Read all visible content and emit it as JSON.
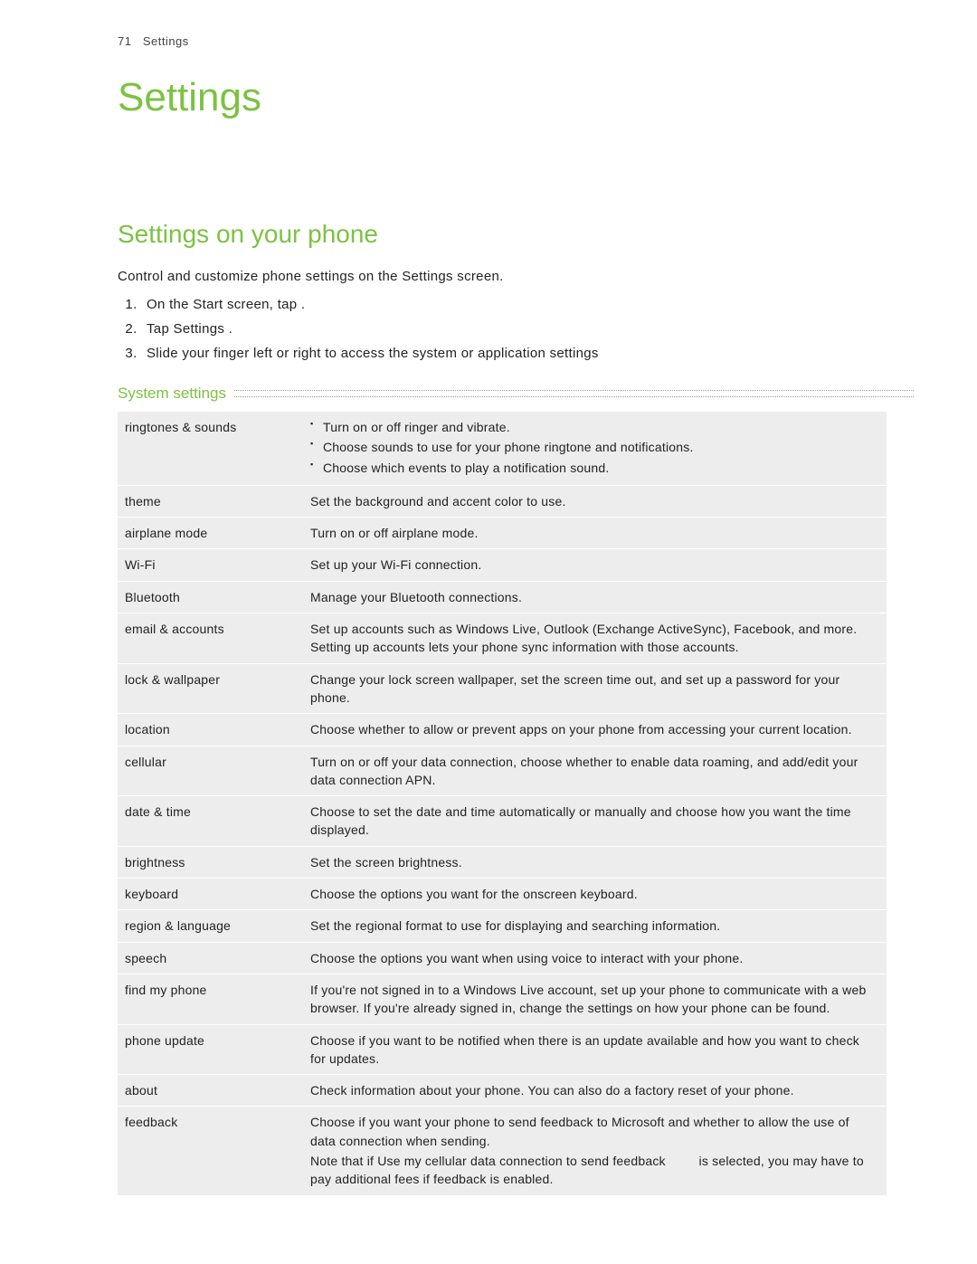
{
  "header": {
    "page_num": "71",
    "section": "Settings"
  },
  "chapter_title": "Settings",
  "section_title": "Settings on your phone",
  "intro": "Control and customize phone settings on the Settings screen.",
  "steps": [
    "On the Start screen, tap        .",
    "Tap Settings .",
    "Slide your finger left or right to access the system or application settings"
  ],
  "subsection_title": "System settings",
  "rows": [
    {
      "label": "ringtones & sounds",
      "bullets": [
        "Turn on or off ringer and vibrate.",
        "Choose sounds to use for your phone ringtone and notifications.",
        "Choose which events to play a notification sound."
      ]
    },
    {
      "label": "theme",
      "desc": "Set the background and accent color to use."
    },
    {
      "label": "airplane mode",
      "desc": "Turn on or off airplane mode."
    },
    {
      "label": "Wi-Fi",
      "desc": "Set up your Wi-Fi connection."
    },
    {
      "label": "Bluetooth",
      "desc": "Manage your Bluetooth connections."
    },
    {
      "label": "email & accounts",
      "desc": "Set up accounts such as Windows Live, Outlook (Exchange ActiveSync), Facebook, and more. Setting up accounts lets your phone sync information with those accounts."
    },
    {
      "label": "lock & wallpaper",
      "desc": "Change your lock screen wallpaper, set the screen time out, and set up a password for your phone."
    },
    {
      "label": "location",
      "desc": "Choose whether to allow or prevent apps on your phone from accessing your current location."
    },
    {
      "label": "cellular",
      "desc": "Turn on or off your data connection, choose whether to enable data roaming, and add/edit your data connection APN."
    },
    {
      "label": "date & time",
      "desc": "Choose to set the date and time automatically or manually and choose how you want the time displayed."
    },
    {
      "label": "brightness",
      "desc": "Set the screen brightness."
    },
    {
      "label": "keyboard",
      "desc": "Choose the options you want for the onscreen keyboard."
    },
    {
      "label": "region & language",
      "desc": "Set the regional format to use for displaying and searching information."
    },
    {
      "label": "speech",
      "desc": "Choose the options you want when using voice to interact with your phone."
    },
    {
      "label": "find my phone",
      "desc": "If you're not signed in to a Windows Live account, set up your phone to communicate with a web browser. If you're already signed in, change the settings on how your phone can be found."
    },
    {
      "label": "phone update",
      "desc": "Choose if you want to be notified when there is an update available and how you want to check for updates."
    },
    {
      "label": "about",
      "desc": "Check information about your phone. You can also do a factory reset of your phone."
    },
    {
      "label": "feedback",
      "desc": "Choose if you want your phone to send feedback to Microsoft and whether to allow the use of data connection when sending.",
      "note_pre": "Note that if Use my cellular data connection to send feedback",
      "note_post": " is selected, you may have to pay additional fees if feedback is enabled."
    }
  ]
}
